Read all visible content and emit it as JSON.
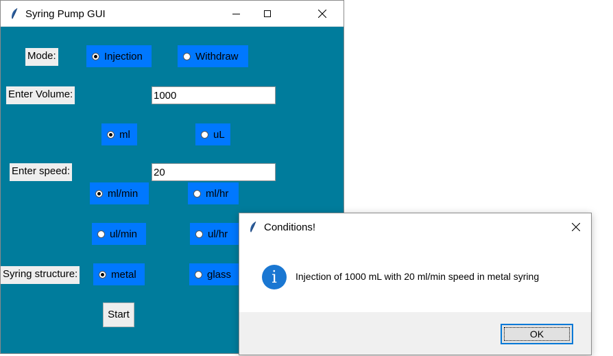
{
  "main_window": {
    "title": "Syring Pump GUI",
    "mode_label": "Mode:",
    "mode_options": [
      {
        "label": "Injection",
        "selected": true
      },
      {
        "label": "Withdraw",
        "selected": false
      }
    ],
    "volume_label": "Enter Volume:",
    "volume_value": "1000",
    "volume_units": [
      {
        "label": "ml",
        "selected": true
      },
      {
        "label": "uL",
        "selected": false
      }
    ],
    "speed_label": "Enter speed:",
    "speed_value": "20",
    "speed_units": [
      {
        "label": "ml/min",
        "selected": true
      },
      {
        "label": "ml/hr",
        "selected": false
      },
      {
        "label": "ul/min",
        "selected": false
      },
      {
        "label": "ul/hr",
        "selected": false
      }
    ],
    "structure_label": "Syring structure:",
    "structure_options": [
      {
        "label": "metal",
        "selected": true
      },
      {
        "label": "glass",
        "selected": false
      }
    ],
    "start_label": "Start"
  },
  "dialog": {
    "title": "Conditions!",
    "icon_glyph": "i",
    "message": "Injection of 1000 mL with 20 ml/min speed in metal syring",
    "ok_label": "OK"
  },
  "icons": {
    "app_icon": "feather-icon",
    "info_icon": "info-icon",
    "minimize": "minimize-icon",
    "maximize": "maximize-icon",
    "close": "close-icon"
  },
  "colors": {
    "window_background": "#007c9c",
    "radio_background": "#0078ff",
    "label_background": "#eeeeee",
    "info_icon": "#1a77d2",
    "focus_border": "#0078d7"
  }
}
